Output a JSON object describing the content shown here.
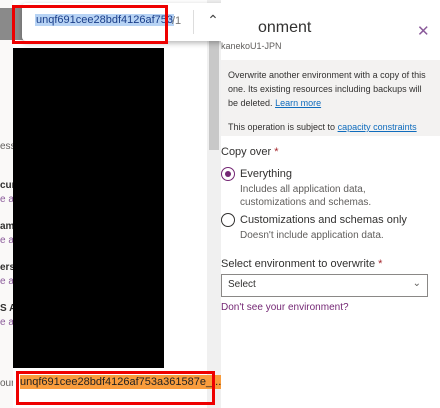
{
  "find_bar": {
    "query": "unqf691cee28bdf4126af753",
    "count": "/1",
    "prev_icon": "chevron-up-icon",
    "next_icon": "chevron-down-icon",
    "close_icon": "close-icon"
  },
  "left_fragments": [
    "ess",
    "cur",
    "e al",
    "ams",
    "e al",
    "ers",
    "e al",
    "S A",
    "e al",
    "our"
  ],
  "highlighted_match": "unqf691cee28bdf4126af753a361587e_...",
  "panel": {
    "title": "onment",
    "subtitle": "kanekoU1-JPN",
    "info_text": "Overwrite another environment with a copy of this one. Its existing resources including backups will be deleted.",
    "learn_more": "Learn more",
    "capacity_prefix": "This operation is subject to",
    "capacity_link": "capacity constraints",
    "copy_over_label": "Copy over",
    "required": "*",
    "options": [
      {
        "label": "Everything",
        "desc1": "Includes all application data,",
        "desc2": "customizations and schemas.",
        "selected": true
      },
      {
        "label": "Customizations and schemas only",
        "desc1": "Doesn't include application data.",
        "desc2": "",
        "selected": false
      }
    ],
    "select_label": "Select environment to overwrite",
    "select_value": "Select",
    "dont_see": "Don't see your environment?"
  },
  "colors": {
    "accent": "#742774",
    "highlight": "#f99c3c",
    "selection": "#b7d3f4",
    "annotation": "#ee0000"
  }
}
